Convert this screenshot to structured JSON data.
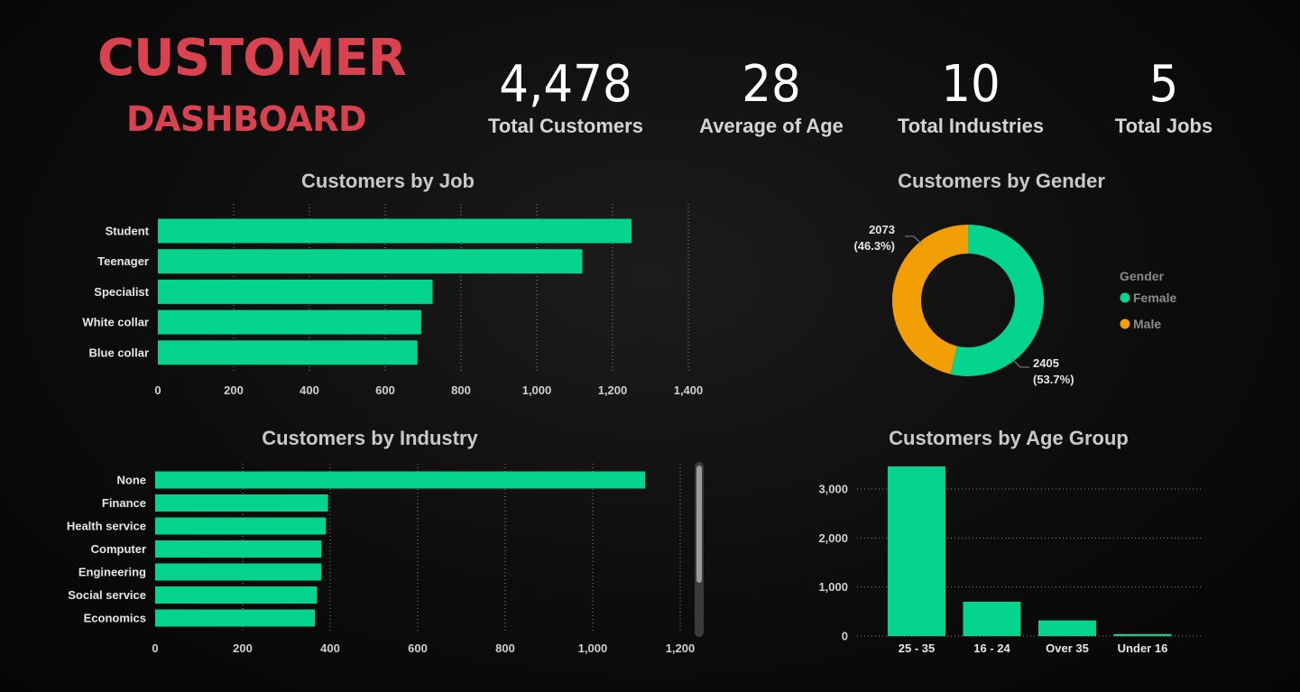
{
  "header": {
    "title": "CUSTOMER",
    "subtitle": "DASHBOARD"
  },
  "kpis": [
    {
      "value": "4,478",
      "label": "Total Customers"
    },
    {
      "value": "28",
      "label": "Average of Age"
    },
    {
      "value": "10",
      "label": "Total Industries"
    },
    {
      "value": "5",
      "label": "Total Jobs"
    }
  ],
  "colors": {
    "accent": "#05d48f",
    "female": "#05d48f",
    "male": "#f29e05",
    "title": "#d9434f"
  },
  "chart_data": [
    {
      "id": "job",
      "type": "bar",
      "orientation": "horizontal",
      "title": "Customers by Job",
      "categories": [
        "Student",
        "Teenager",
        "Specialist",
        "White collar",
        "Blue collar"
      ],
      "values": [
        1250,
        1120,
        725,
        695,
        685
      ],
      "xlim": [
        0,
        1400
      ],
      "ticks": [
        0,
        200,
        400,
        600,
        800,
        1000,
        1200,
        1400
      ],
      "tick_labels": [
        "0",
        "200",
        "400",
        "600",
        "800",
        "1,000",
        "1,200",
        "1,400"
      ],
      "grid": true
    },
    {
      "id": "industry",
      "type": "bar",
      "orientation": "horizontal",
      "title": "Customers by Industry",
      "categories": [
        "None",
        "Finance",
        "Health service",
        "Computer",
        "Engineering",
        "Social service",
        "Economics"
      ],
      "values": [
        1120,
        395,
        390,
        380,
        380,
        370,
        365
      ],
      "xlim": [
        0,
        1200
      ],
      "ticks": [
        0,
        200,
        400,
        600,
        800,
        1000,
        1200
      ],
      "tick_labels": [
        "0",
        "200",
        "400",
        "600",
        "800",
        "1,000",
        "1,200"
      ],
      "grid": true
    },
    {
      "id": "gender",
      "type": "pie",
      "donut": true,
      "title": "Customers by Gender",
      "legend_title": "Gender",
      "legend_position": "right",
      "categories": [
        "Female",
        "Male"
      ],
      "values": [
        2405,
        2073
      ],
      "data_labels": [
        {
          "value": "2405",
          "pct": "(53.7%)"
        },
        {
          "value": "2073",
          "pct": "(46.3%)"
        }
      ]
    },
    {
      "id": "age",
      "type": "bar",
      "orientation": "vertical",
      "title": "Customers by Age Group",
      "categories": [
        "25 - 35",
        "16 - 24",
        "Over 35",
        "Under 16"
      ],
      "values": [
        3460,
        700,
        320,
        40
      ],
      "ylim": [
        0,
        3600
      ],
      "ticks": [
        0,
        1000,
        2000,
        3000
      ],
      "tick_labels": [
        "0",
        "1,000",
        "2,000",
        "3,000"
      ],
      "grid": true
    }
  ]
}
